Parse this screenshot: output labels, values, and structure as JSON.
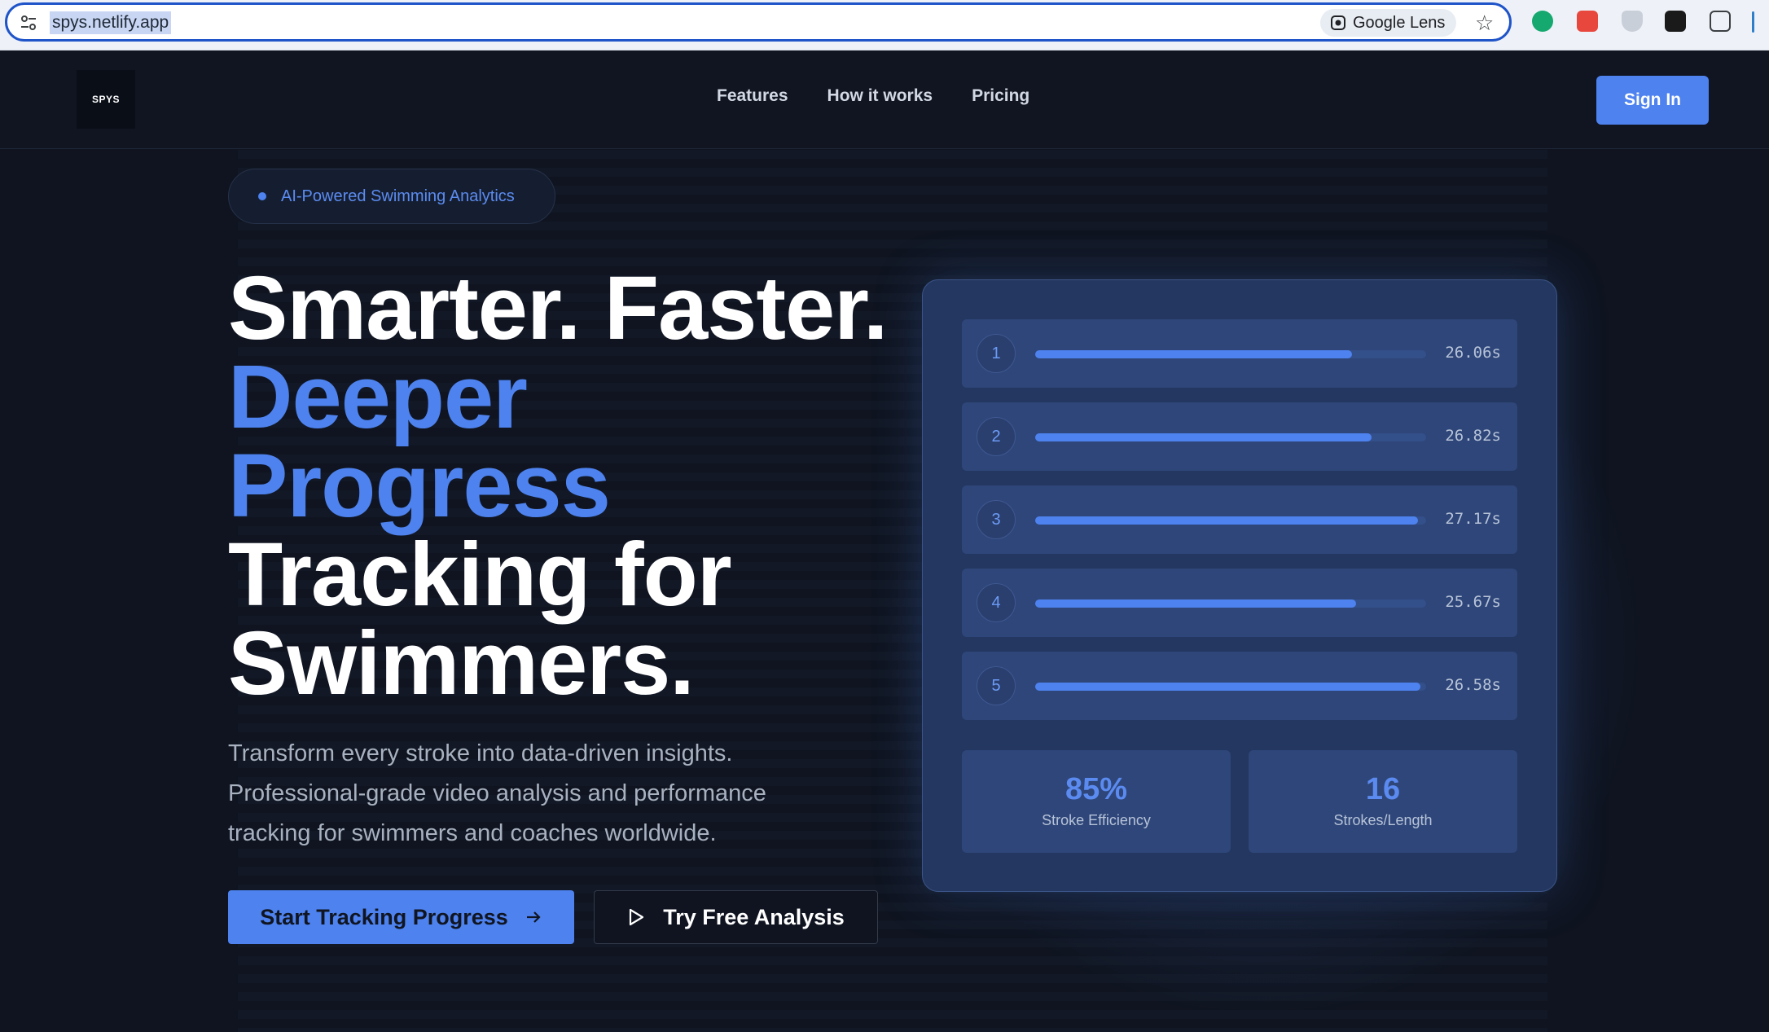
{
  "browser": {
    "url": "spys.netlify.app",
    "lens_label": "Google Lens"
  },
  "nav": {
    "logo": "SPYS",
    "links": [
      "Features",
      "How it works",
      "Pricing"
    ],
    "signin": "Sign In"
  },
  "hero": {
    "badge": "AI-Powered Swimming Analytics",
    "headline": {
      "line1": "Smarter. Faster.",
      "line2": "Deeper",
      "line3": "Progress",
      "line4": "Tracking for",
      "line5": "Swimmers."
    },
    "subtext": "Transform every stroke into data-driven insights. Professional-grade video analysis and performance tracking for swimmers and coaches worldwide.",
    "primary_cta": "Start Tracking Progress",
    "secondary_cta": "Try Free Analysis"
  },
  "card": {
    "laps": [
      {
        "number": "1",
        "time": "26.06s",
        "progress": 0.81
      },
      {
        "number": "2",
        "time": "26.82s",
        "progress": 0.86
      },
      {
        "number": "3",
        "time": "27.17s",
        "progress": 0.98
      },
      {
        "number": "4",
        "time": "25.67s",
        "progress": 0.82
      },
      {
        "number": "5",
        "time": "26.58s",
        "progress": 0.985
      }
    ],
    "stats": [
      {
        "value": "85%",
        "label": "Stroke Efficiency"
      },
      {
        "value": "16",
        "label": "Strokes/Length"
      }
    ]
  },
  "colors": {
    "accent": "#4d82ef",
    "background": "#0f1420",
    "card": "#243760"
  }
}
